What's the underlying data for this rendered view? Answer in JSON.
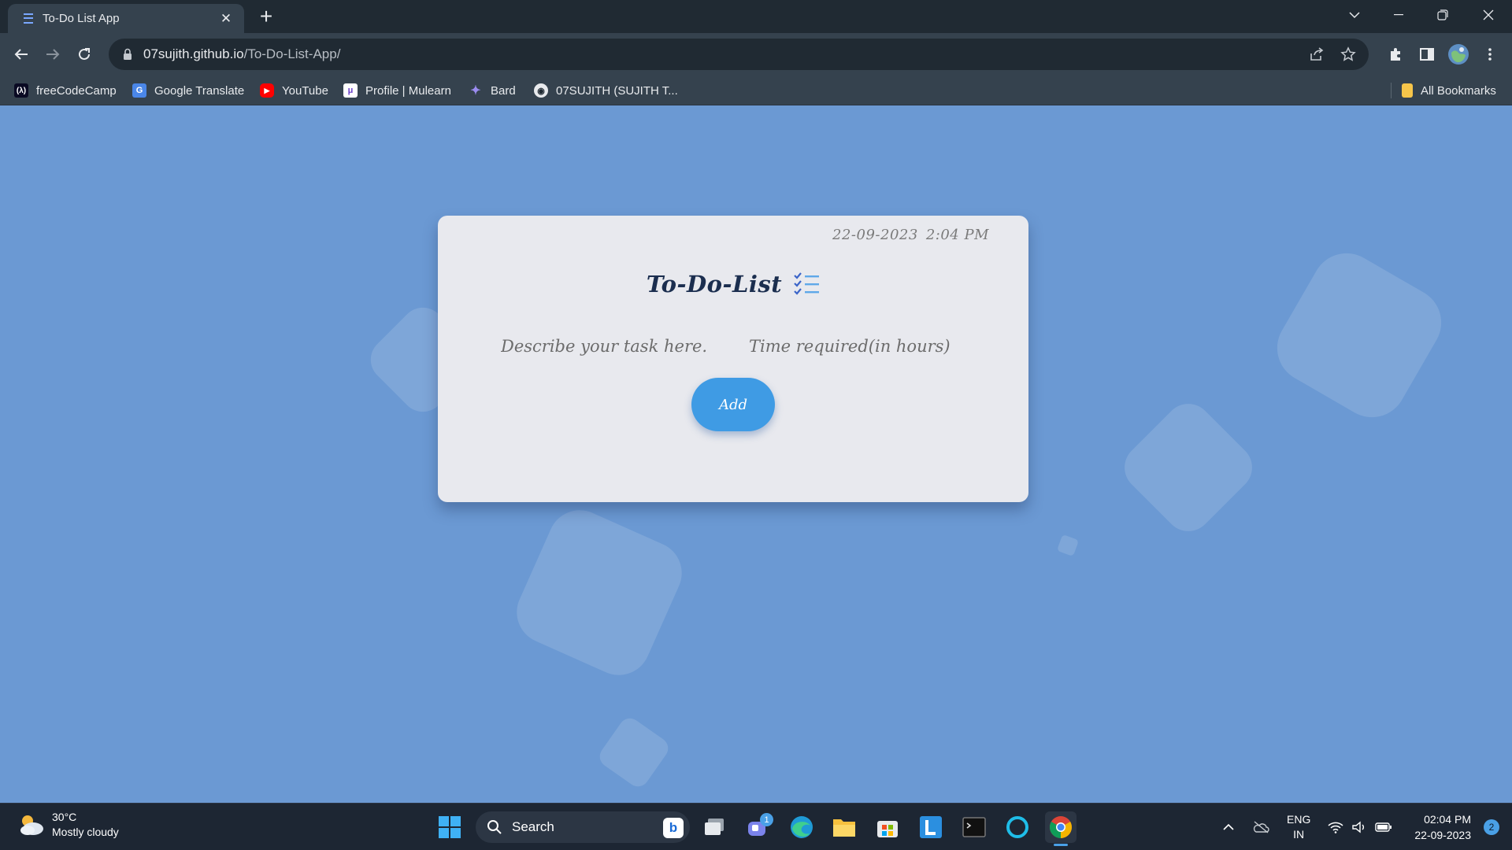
{
  "browser": {
    "tab_title": "To-Do List App",
    "url_domain": "07sujith.github.io",
    "url_path": "/To-Do-List-App/",
    "bookmarks": [
      {
        "label": "freeCodeCamp",
        "icon": "freecodecamp-icon"
      },
      {
        "label": "Google Translate",
        "icon": "google-translate-icon"
      },
      {
        "label": "YouTube",
        "icon": "youtube-icon"
      },
      {
        "label": "Profile | Mulearn",
        "icon": "mulearn-icon"
      },
      {
        "label": "Bard",
        "icon": "bard-icon"
      },
      {
        "label": "07SUJITH (SUJITH T...",
        "icon": "github-icon"
      }
    ],
    "all_bookmarks_label": "All Bookmarks"
  },
  "app": {
    "date": "22-09-2023",
    "time": "2:04 PM",
    "title": "To-Do-List",
    "task_placeholder": "Describe your task here.",
    "time_placeholder": "Time required(in hours)",
    "add_label": "Add"
  },
  "taskbar": {
    "temperature": "30°C",
    "weather": "Mostly cloudy",
    "search_label": "Search",
    "teams_badge": "1",
    "language": "ENG",
    "region": "IN",
    "clock_time": "02:04 PM",
    "clock_date": "22-09-2023",
    "notification_count": "2"
  },
  "colors": {
    "page_background": "#6b99d3",
    "card_background": "#e8e9ee",
    "add_button": "#3f9be4",
    "title_text": "#1b2e4f"
  }
}
